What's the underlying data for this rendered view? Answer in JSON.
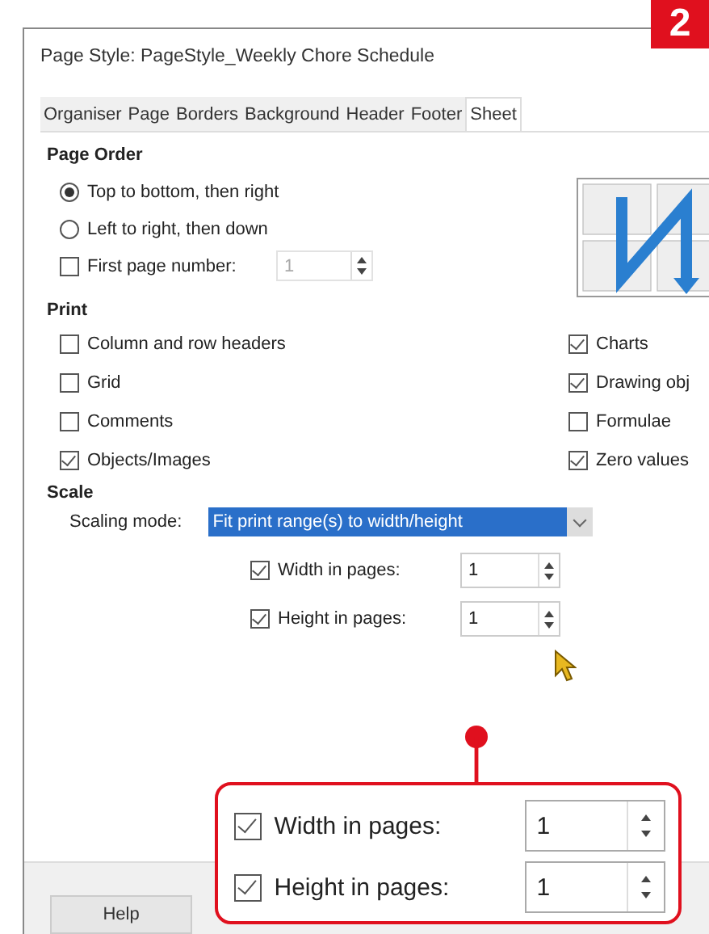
{
  "badge": "2",
  "window": {
    "title": "Page Style: PageStyle_Weekly Chore Schedule"
  },
  "tabs": [
    {
      "label": "Organiser",
      "selected": false
    },
    {
      "label": "Page",
      "selected": false
    },
    {
      "label": "Borders",
      "selected": false
    },
    {
      "label": "Background",
      "selected": false
    },
    {
      "label": "Header",
      "selected": false
    },
    {
      "label": "Footer",
      "selected": false
    },
    {
      "label": "Sheet",
      "selected": true
    }
  ],
  "page_order": {
    "heading": "Page Order",
    "options": [
      {
        "label": "Top to bottom, then right",
        "selected": true
      },
      {
        "label": "Left to right, then down",
        "selected": false
      }
    ],
    "first_page_number": {
      "label": "First page number:",
      "checked": false,
      "value": "1",
      "disabled": true
    }
  },
  "print": {
    "heading": "Print",
    "left": [
      {
        "label": "Column and row headers",
        "checked": false
      },
      {
        "label": "Grid",
        "checked": false
      },
      {
        "label": "Comments",
        "checked": false
      },
      {
        "label": "Objects/Images",
        "checked": true
      }
    ],
    "right": [
      {
        "label": "Charts",
        "checked": true
      },
      {
        "label": "Drawing obj",
        "checked": true
      },
      {
        "label": "Formulae",
        "checked": false
      },
      {
        "label": "Zero values",
        "checked": true
      }
    ]
  },
  "scale": {
    "heading": "Scale",
    "mode_label": "Scaling mode:",
    "mode_value": "Fit print range(s) to width/height",
    "fields": [
      {
        "label": "Width in pages:",
        "checked": true,
        "value": "1"
      },
      {
        "label": "Height in pages:",
        "checked": true,
        "value": "1"
      }
    ]
  },
  "callout": {
    "fields": [
      {
        "label": "Width in pages:",
        "checked": true,
        "value": "1"
      },
      {
        "label": "Height in pages:",
        "checked": true,
        "value": "1"
      }
    ]
  },
  "buttons": [
    {
      "label": "Help"
    }
  ]
}
